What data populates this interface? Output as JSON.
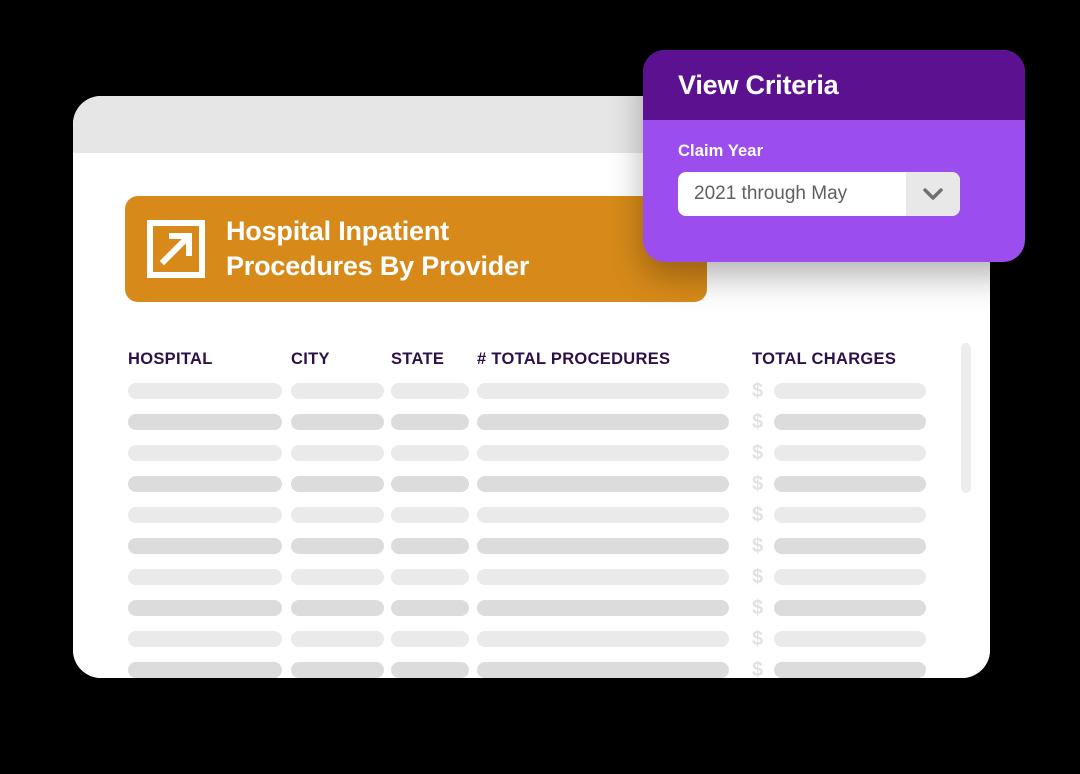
{
  "window": {
    "titlebar_label": ""
  },
  "report": {
    "icon": "external-link-square-icon",
    "title": "Hospital Inpatient\nProcedures By Provider",
    "accent_color": "#d78a19"
  },
  "table": {
    "columns": [
      {
        "key": "hospital",
        "label": "HOSPITAL"
      },
      {
        "key": "city",
        "label": "CITY"
      },
      {
        "key": "state",
        "label": "STATE"
      },
      {
        "key": "procedures",
        "label": "# TOTAL PROCEDURES"
      },
      {
        "key": "charges",
        "label": "TOTAL CHARGES"
      }
    ],
    "header_color": "#2d1048",
    "currency_symbol": "$",
    "skeleton_row_count": 12,
    "skeleton_colors": {
      "light": "#eaeaea",
      "dark": "#dcdcdc"
    }
  },
  "criteria": {
    "header_title": "View Criteria",
    "header_color": "#5c1191",
    "body_color": "#9b4dee",
    "field_label": "Claim Year",
    "select_value": "2021 through May",
    "select_icon": "chevron-down-icon"
  }
}
